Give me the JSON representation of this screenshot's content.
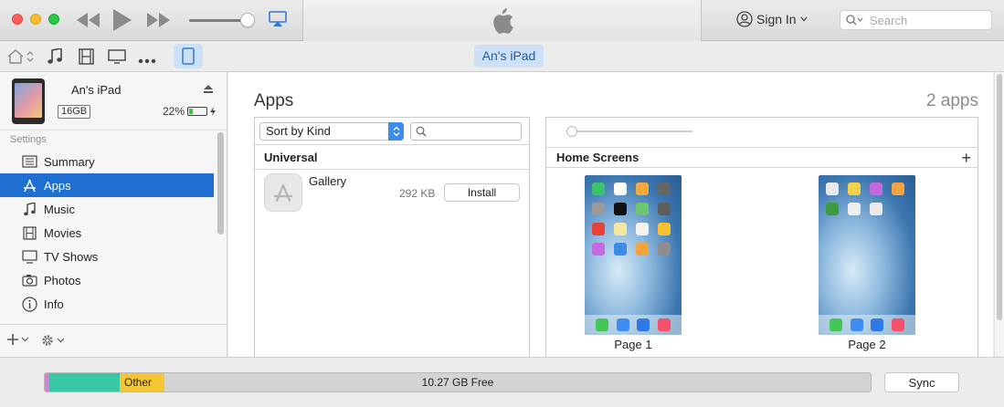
{
  "window": {
    "signin_label": "Sign In",
    "search_placeholder": "Search"
  },
  "toolbar": {
    "device_pill": "An's iPad"
  },
  "device": {
    "name": "An's iPad",
    "capacity": "16GB",
    "battery": "22%",
    "battery_level": 0.22
  },
  "sidebar": {
    "section": "Settings",
    "items": [
      {
        "label": "Summary",
        "icon": "summary-icon",
        "active": false
      },
      {
        "label": "Apps",
        "icon": "apps-icon",
        "active": true
      },
      {
        "label": "Music",
        "icon": "music-note-icon",
        "active": false
      },
      {
        "label": "Movies",
        "icon": "film-icon",
        "active": false
      },
      {
        "label": "TV Shows",
        "icon": "tv-icon",
        "active": false
      },
      {
        "label": "Photos",
        "icon": "camera-icon",
        "active": false
      },
      {
        "label": "Info",
        "icon": "info-icon",
        "active": false
      }
    ]
  },
  "main": {
    "title": "Apps",
    "count": "2 apps",
    "sort": "Sort by Kind",
    "group": "Universal",
    "apps": [
      {
        "name": "Gallery",
        "size": "292 KB",
        "action": "Install"
      }
    ],
    "home_screens_label": "Home Screens",
    "pages": [
      "Page 1",
      "Page 2"
    ]
  },
  "storage": {
    "other_label": "Other",
    "free_label": "10.27 GB Free",
    "sync_label": "Sync",
    "colors": {
      "pink": "#d77ed6",
      "apps": "#39c8a6",
      "other": "#f6c632",
      "free": "#d3d3d3"
    }
  },
  "colors": {
    "accent": "#1f6fd1",
    "selection": "#cde0f5"
  }
}
